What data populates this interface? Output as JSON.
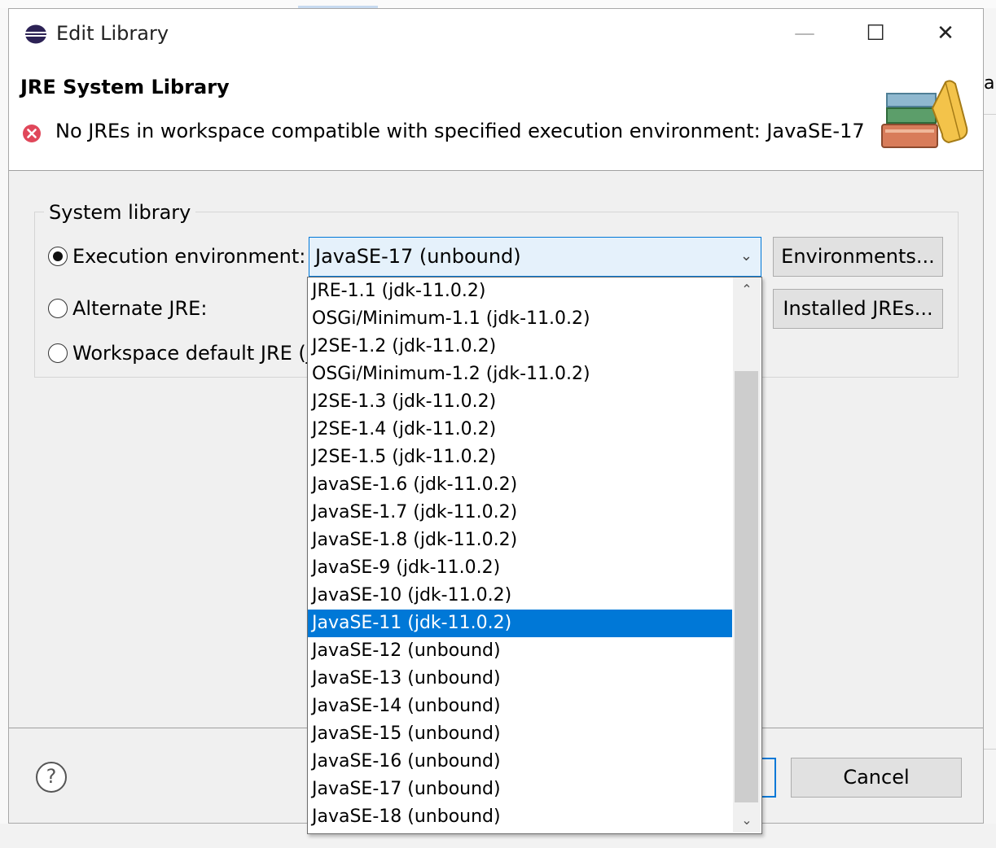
{
  "window": {
    "title": "Edit Library",
    "minimize_glyph": "—",
    "maximize_glyph": "☐",
    "close_glyph": "✕"
  },
  "header": {
    "title": "JRE System Library",
    "error_message": "No JREs in workspace compatible with specified execution environment: JavaSE-17"
  },
  "system_library": {
    "group_label": "System library",
    "execution_environment_label": "Execution environment:",
    "alternate_jre_label": "Alternate JRE:",
    "workspace_default_label": "Workspace default JRE (j",
    "selected_radio": "execution_environment",
    "combo_value": "JavaSE-17 (unbound)",
    "environments_button": "Environments...",
    "installed_jres_button": "Installed JREs..."
  },
  "dropdown": {
    "selected_index": 12,
    "items": [
      "JRE-1.1 (jdk-11.0.2)",
      "OSGi/Minimum-1.1 (jdk-11.0.2)",
      "J2SE-1.2 (jdk-11.0.2)",
      "OSGi/Minimum-1.2 (jdk-11.0.2)",
      "J2SE-1.3 (jdk-11.0.2)",
      "J2SE-1.4 (jdk-11.0.2)",
      "J2SE-1.5 (jdk-11.0.2)",
      "JavaSE-1.6 (jdk-11.0.2)",
      "JavaSE-1.7 (jdk-11.0.2)",
      "JavaSE-1.8 (jdk-11.0.2)",
      "JavaSE-9 (jdk-11.0.2)",
      "JavaSE-10 (jdk-11.0.2)",
      "JavaSE-11 (jdk-11.0.2)",
      "JavaSE-12 (unbound)",
      "JavaSE-13 (unbound)",
      "JavaSE-14 (unbound)",
      "JavaSE-15 (unbound)",
      "JavaSE-16 (unbound)",
      "JavaSE-17 (unbound)",
      "JavaSE-18 (unbound)"
    ]
  },
  "footer": {
    "help_glyph": "?",
    "cancel_button": "Cancel"
  },
  "background": {
    "partial_text": "ar"
  },
  "colors": {
    "accent": "#0078d7",
    "error": "#e0475a",
    "dialog_bg": "#f0f0f0"
  }
}
